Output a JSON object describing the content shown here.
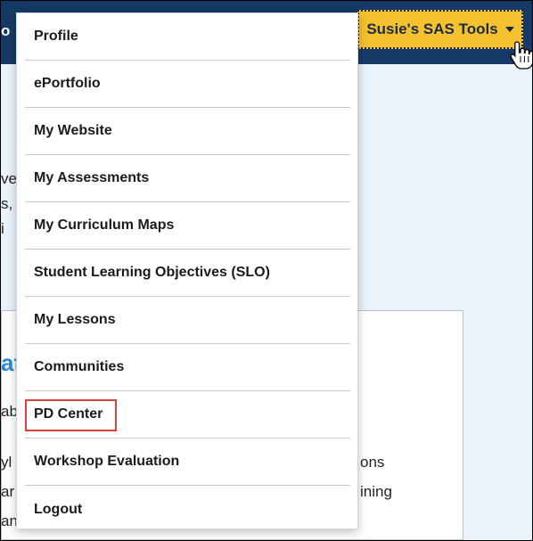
{
  "header": {
    "brand_fragment": "o",
    "tools_button": "Susie's SAS Tools"
  },
  "background_fragments": {
    "line1": "ve",
    "line2": "s, c",
    "line3": "i",
    "heading": "at",
    "line5": "ab",
    "line6_left": "yl",
    "line6_right": "ons",
    "line7_left": "ar",
    "line7_right": "ining",
    "line8": "an"
  },
  "menu": {
    "items": [
      "Profile",
      "ePortfolio",
      "My Website",
      "My Assessments",
      "My Curriculum Maps",
      "Student Learning Objectives (SLO)",
      "My Lessons",
      "Communities",
      "PD Center",
      "Workshop Evaluation",
      "Logout"
    ],
    "highlighted_item": "PD Center"
  },
  "colors": {
    "header": "#153a66",
    "button": "#f6c12f",
    "highlight": "#d9423f",
    "accent": "#2a8ad1"
  }
}
